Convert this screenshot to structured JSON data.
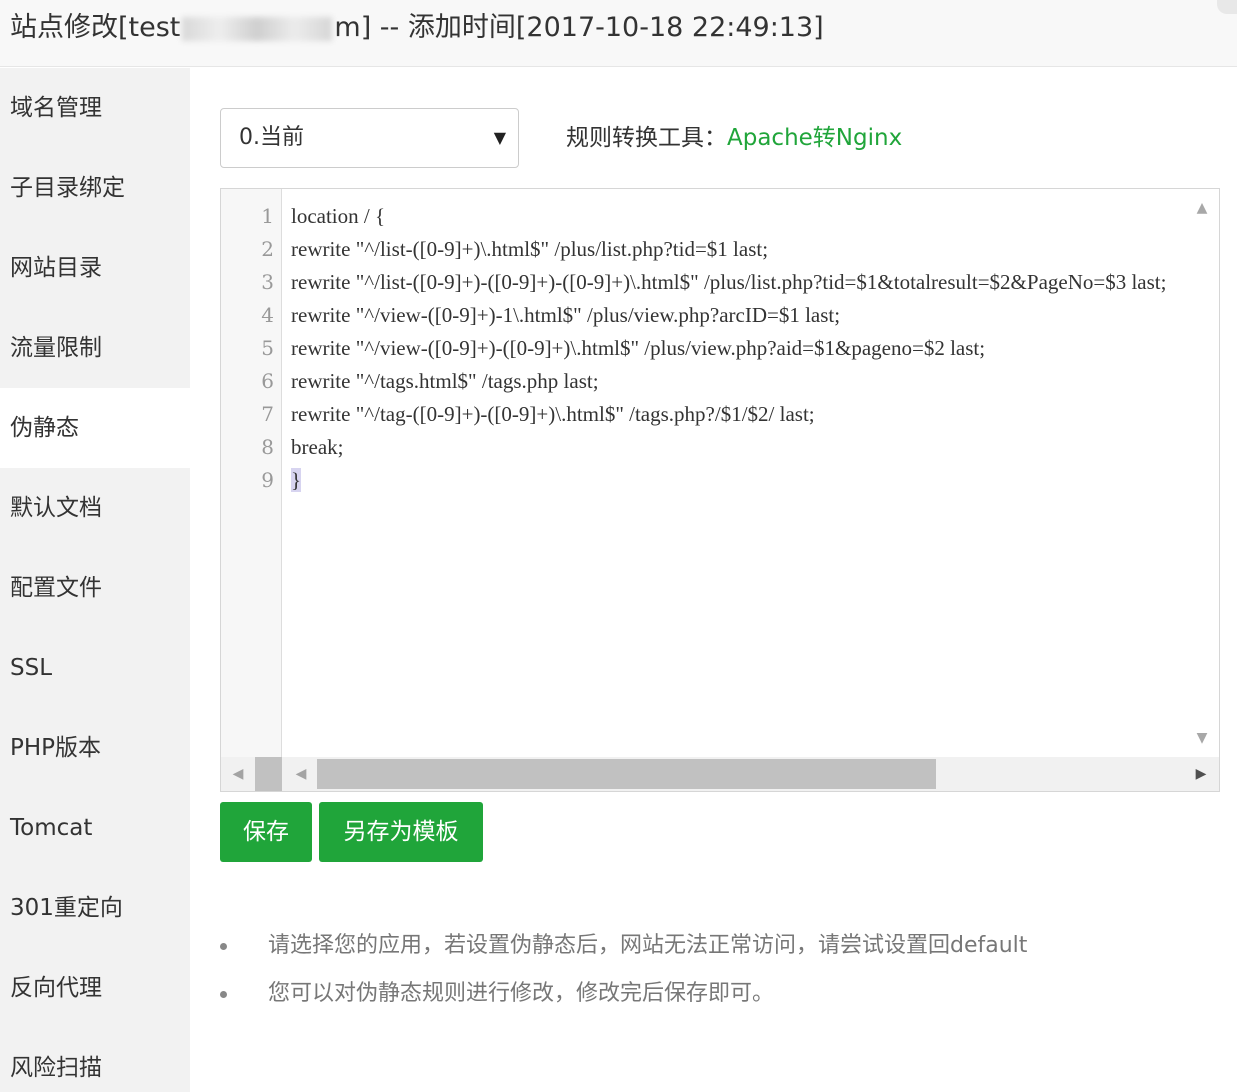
{
  "title": {
    "prefix": "站点修改[test",
    "suffix": "m] -- 添加时间[2017-10-18 22:49:13]"
  },
  "sidebar": {
    "items": [
      {
        "label": "域名管理"
      },
      {
        "label": "子目录绑定"
      },
      {
        "label": "网站目录"
      },
      {
        "label": "流量限制"
      },
      {
        "label": "伪静态",
        "active": true
      },
      {
        "label": "默认文档"
      },
      {
        "label": "配置文件"
      },
      {
        "label": "SSL"
      },
      {
        "label": "PHP版本"
      },
      {
        "label": "Tomcat"
      },
      {
        "label": "301重定向"
      },
      {
        "label": "反向代理"
      },
      {
        "label": "风险扫描"
      }
    ]
  },
  "rewrite": {
    "selected_rule": "0.当前",
    "tool_label": "规则转换工具：",
    "tool_link": "Apache转Nginx"
  },
  "editor": {
    "line_numbers": [
      "1",
      "2",
      "3",
      "4",
      "5",
      "6",
      "7",
      "8",
      "9"
    ],
    "lines": [
      "location / {",
      "rewrite \"^/list-([0-9]+)\\.html$\" /plus/list.php?tid=$1 last;",
      "rewrite \"^/list-([0-9]+)-([0-9]+)-([0-9]+)\\.html$\" /plus/list.php?tid=$1&totalresult=$2&PageNo=$3 last;",
      "rewrite \"^/view-([0-9]+)-1\\.html$\" /plus/view.php?arcID=$1 last;",
      "rewrite \"^/view-([0-9]+)-([0-9]+)\\.html$\" /plus/view.php?aid=$1&pageno=$2 last;",
      "rewrite \"^/tags.html$\" /tags.php last;",
      "rewrite \"^/tag-([0-9]+)-([0-9]+)\\.html$\" /tags.php?/$1/$2/ last;",
      "break;",
      "}"
    ]
  },
  "buttons": {
    "save": "保存",
    "save_template": "另存为模板"
  },
  "notes": [
    "请选择您的应用，若设置伪静态后，网站无法正常访问，请尝试设置回default",
    "您可以对伪静态规则进行修改，修改完后保存即可。"
  ],
  "colors": {
    "accent": "#20a53a",
    "sidebar_bg": "#f2f2f2"
  }
}
